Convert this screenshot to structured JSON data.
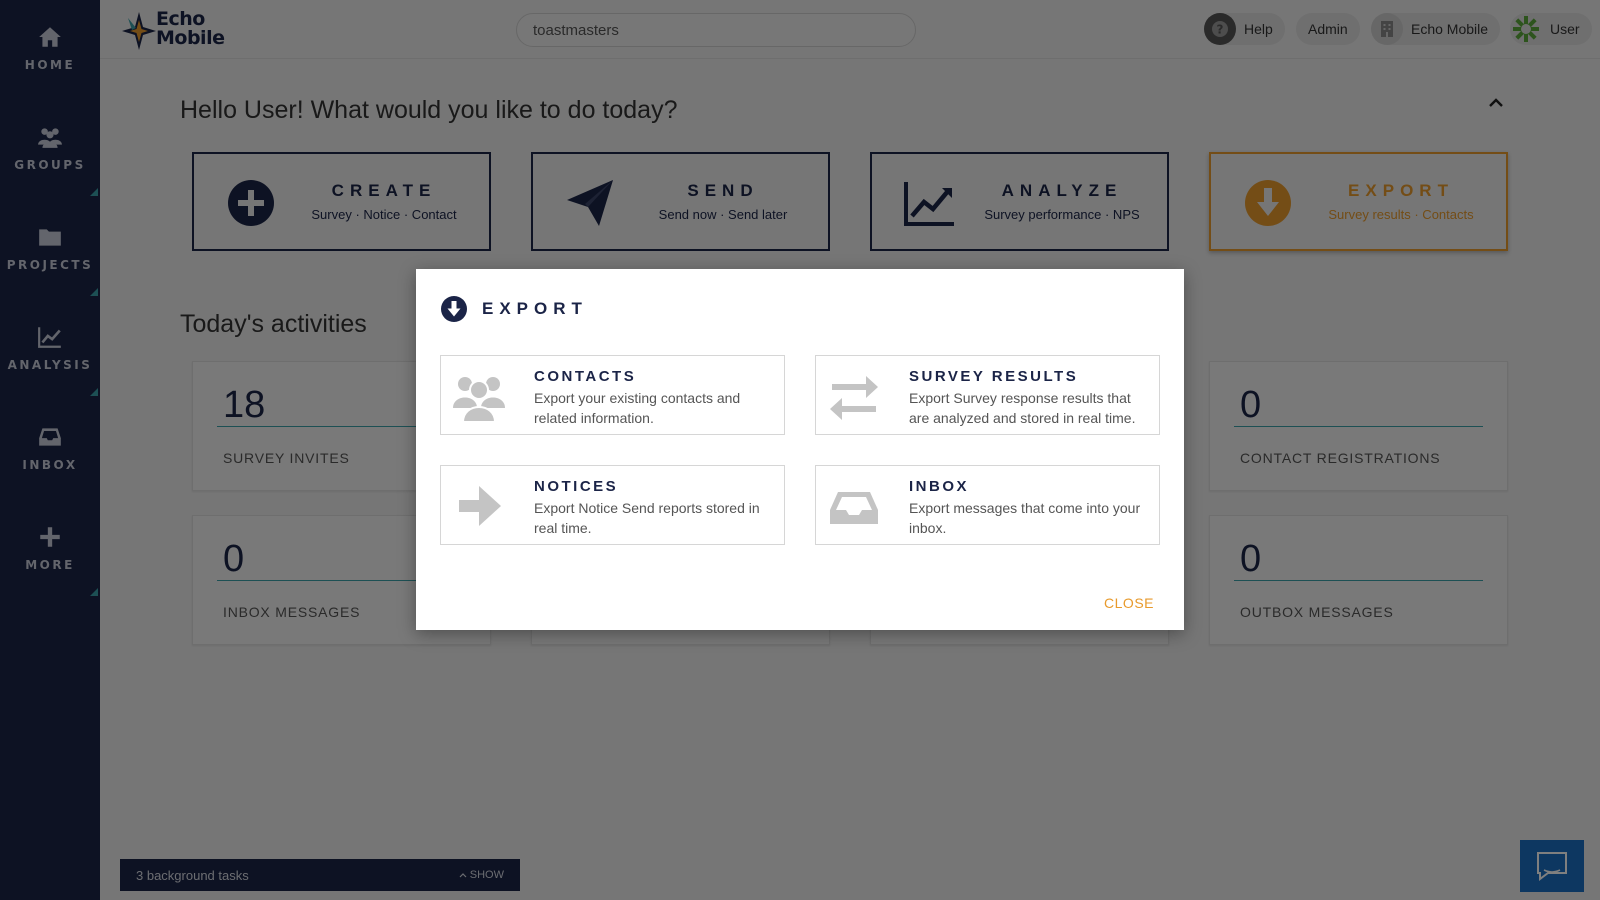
{
  "sidebar": {
    "items": [
      {
        "label": "HOME",
        "icon": "home-icon"
      },
      {
        "label": "GROUPS",
        "icon": "groups-icon"
      },
      {
        "label": "PROJECTS",
        "icon": "folder-icon"
      },
      {
        "label": "ANALYSIS",
        "icon": "chart-line-icon"
      },
      {
        "label": "INBOX",
        "icon": "inbox-icon"
      },
      {
        "label": "MORE",
        "icon": "plus-icon"
      }
    ]
  },
  "topbar": {
    "logo": {
      "line1": "Echo",
      "line2": "Mobile"
    },
    "search": {
      "value": "toastmasters",
      "placeholder": ""
    },
    "help_label": "Help",
    "admin_label": "Admin",
    "org_label": "Echo Mobile",
    "user_label": "User"
  },
  "main": {
    "greeting": "Hello User! What would you like to do today?",
    "actions": [
      {
        "title": "CREATE",
        "subtitle": "Survey · Notice · Contact",
        "icon": "plus-circle-icon"
      },
      {
        "title": "SEND",
        "subtitle": "Send now · Send later",
        "icon": "paper-plane-icon"
      },
      {
        "title": "ANALYZE",
        "subtitle": "Survey performance · NPS",
        "icon": "chart-line-icon"
      },
      {
        "title": "EXPORT",
        "subtitle": "Survey results · Contacts",
        "icon": "arrow-down-circle-icon"
      }
    ],
    "activities_title": "Today's activities",
    "stats": [
      {
        "value": "18",
        "label": "SURVEY INVITES"
      },
      {
        "value": "0",
        "label": "CONTACT REGISTRATIONS"
      },
      {
        "value": "0",
        "label": "INBOX MESSAGES"
      },
      {
        "value": "0",
        "label": "OUTBOX MESSAGES"
      }
    ]
  },
  "background_tasks": {
    "label": "3 background tasks",
    "show_label": "SHOW"
  },
  "modal": {
    "title": "EXPORT",
    "options": [
      {
        "title": "CONTACTS",
        "description": "Export your existing contacts and related information.",
        "icon": "users-icon"
      },
      {
        "title": "SURVEY RESULTS",
        "description": "Export Survey response results that are analyzed and stored in real time.",
        "icon": "exchange-arrows-icon"
      },
      {
        "title": "NOTICES",
        "description": "Export Notice Send reports stored in real time.",
        "icon": "arrow-right-icon"
      },
      {
        "title": "INBOX",
        "description": "Export messages that come into your inbox.",
        "icon": "inbox-icon"
      }
    ],
    "close_label": "CLOSE"
  },
  "colors": {
    "navy": "#1b2447",
    "accent_orange": "#e89a2c",
    "teal": "#3aa0a8",
    "chat_blue": "#1a6fc2"
  }
}
